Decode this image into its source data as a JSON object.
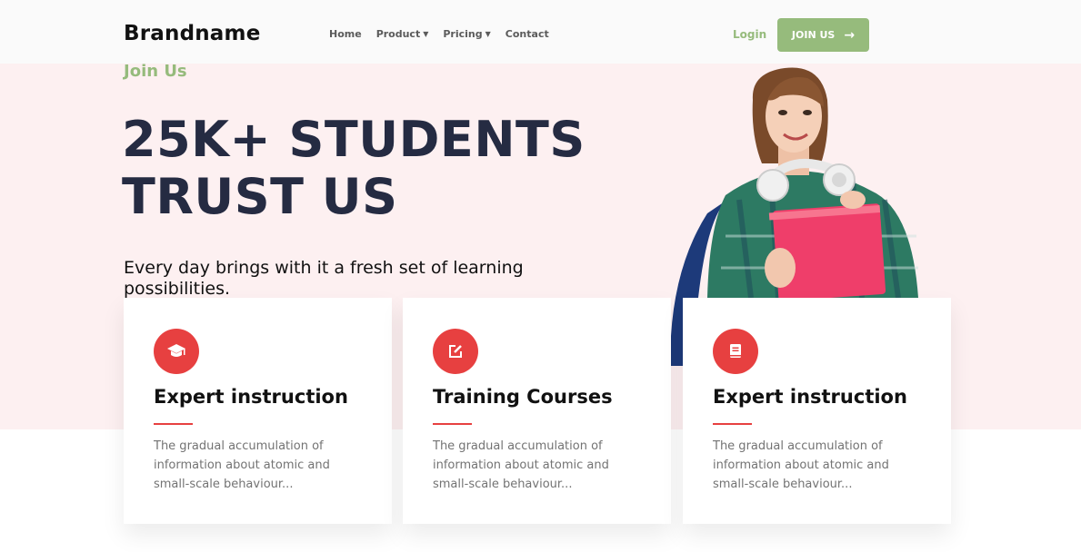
{
  "navbar": {
    "brand": "Brandname",
    "links": [
      {
        "label": "Home",
        "has_caret": false
      },
      {
        "label": "Product",
        "has_caret": true
      },
      {
        "label": "Pricing",
        "has_caret": true
      },
      {
        "label": "Contact",
        "has_caret": false
      }
    ],
    "login_label": "Login",
    "join_label": "JOIN US",
    "join_icon": "arrow-right-icon"
  },
  "hero": {
    "tagline": "Join Us",
    "headline_line1": "25K+ STUDENTS",
    "headline_line2": "TRUST US",
    "subtext": "Every day brings with it a fresh set of learning possibilities.",
    "image": "student-with-book-photo"
  },
  "cards": [
    {
      "icon": "graduation-cap-icon",
      "title": "Expert instruction",
      "text": "The gradual accumulation of information about atomic and small-scale behaviour..."
    },
    {
      "icon": "edit-icon",
      "title": "Training Courses",
      "text": "The gradual accumulation of information about atomic and small-scale behaviour..."
    },
    {
      "icon": "book-icon",
      "title": "Expert instruction",
      "text": "The gradual accumulation of information about atomic and small-scale behaviour..."
    }
  ],
  "colors": {
    "accent_green": "#96BB7C",
    "accent_red": "#E74040",
    "hero_bg": "#FDF0F1",
    "heading": "#252B42",
    "muted_text": "#737373"
  }
}
